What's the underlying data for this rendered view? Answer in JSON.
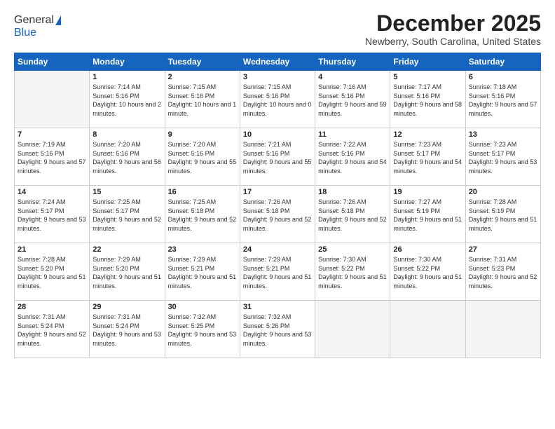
{
  "logo": {
    "general": "General",
    "blue": "Blue"
  },
  "header": {
    "month": "December 2025",
    "location": "Newberry, South Carolina, United States"
  },
  "days_of_week": [
    "Sunday",
    "Monday",
    "Tuesday",
    "Wednesday",
    "Thursday",
    "Friday",
    "Saturday"
  ],
  "weeks": [
    [
      {
        "day": "",
        "empty": true
      },
      {
        "day": "1",
        "sunrise": "7:14 AM",
        "sunset": "5:16 PM",
        "daylight": "10 hours and 2 minutes."
      },
      {
        "day": "2",
        "sunrise": "7:15 AM",
        "sunset": "5:16 PM",
        "daylight": "10 hours and 1 minute."
      },
      {
        "day": "3",
        "sunrise": "7:15 AM",
        "sunset": "5:16 PM",
        "daylight": "10 hours and 0 minutes."
      },
      {
        "day": "4",
        "sunrise": "7:16 AM",
        "sunset": "5:16 PM",
        "daylight": "9 hours and 59 minutes."
      },
      {
        "day": "5",
        "sunrise": "7:17 AM",
        "sunset": "5:16 PM",
        "daylight": "9 hours and 58 minutes."
      },
      {
        "day": "6",
        "sunrise": "7:18 AM",
        "sunset": "5:16 PM",
        "daylight": "9 hours and 57 minutes."
      }
    ],
    [
      {
        "day": "7",
        "sunrise": "7:19 AM",
        "sunset": "5:16 PM",
        "daylight": "9 hours and 57 minutes."
      },
      {
        "day": "8",
        "sunrise": "7:20 AM",
        "sunset": "5:16 PM",
        "daylight": "9 hours and 56 minutes."
      },
      {
        "day": "9",
        "sunrise": "7:20 AM",
        "sunset": "5:16 PM",
        "daylight": "9 hours and 55 minutes."
      },
      {
        "day": "10",
        "sunrise": "7:21 AM",
        "sunset": "5:16 PM",
        "daylight": "9 hours and 55 minutes."
      },
      {
        "day": "11",
        "sunrise": "7:22 AM",
        "sunset": "5:16 PM",
        "daylight": "9 hours and 54 minutes."
      },
      {
        "day": "12",
        "sunrise": "7:23 AM",
        "sunset": "5:17 PM",
        "daylight": "9 hours and 54 minutes."
      },
      {
        "day": "13",
        "sunrise": "7:23 AM",
        "sunset": "5:17 PM",
        "daylight": "9 hours and 53 minutes."
      }
    ],
    [
      {
        "day": "14",
        "sunrise": "7:24 AM",
        "sunset": "5:17 PM",
        "daylight": "9 hours and 53 minutes."
      },
      {
        "day": "15",
        "sunrise": "7:25 AM",
        "sunset": "5:17 PM",
        "daylight": "9 hours and 52 minutes."
      },
      {
        "day": "16",
        "sunrise": "7:25 AM",
        "sunset": "5:18 PM",
        "daylight": "9 hours and 52 minutes."
      },
      {
        "day": "17",
        "sunrise": "7:26 AM",
        "sunset": "5:18 PM",
        "daylight": "9 hours and 52 minutes."
      },
      {
        "day": "18",
        "sunrise": "7:26 AM",
        "sunset": "5:18 PM",
        "daylight": "9 hours and 52 minutes."
      },
      {
        "day": "19",
        "sunrise": "7:27 AM",
        "sunset": "5:19 PM",
        "daylight": "9 hours and 51 minutes."
      },
      {
        "day": "20",
        "sunrise": "7:28 AM",
        "sunset": "5:19 PM",
        "daylight": "9 hours and 51 minutes."
      }
    ],
    [
      {
        "day": "21",
        "sunrise": "7:28 AM",
        "sunset": "5:20 PM",
        "daylight": "9 hours and 51 minutes."
      },
      {
        "day": "22",
        "sunrise": "7:29 AM",
        "sunset": "5:20 PM",
        "daylight": "9 hours and 51 minutes."
      },
      {
        "day": "23",
        "sunrise": "7:29 AM",
        "sunset": "5:21 PM",
        "daylight": "9 hours and 51 minutes."
      },
      {
        "day": "24",
        "sunrise": "7:29 AM",
        "sunset": "5:21 PM",
        "daylight": "9 hours and 51 minutes."
      },
      {
        "day": "25",
        "sunrise": "7:30 AM",
        "sunset": "5:22 PM",
        "daylight": "9 hours and 51 minutes."
      },
      {
        "day": "26",
        "sunrise": "7:30 AM",
        "sunset": "5:22 PM",
        "daylight": "9 hours and 51 minutes."
      },
      {
        "day": "27",
        "sunrise": "7:31 AM",
        "sunset": "5:23 PM",
        "daylight": "9 hours and 52 minutes."
      }
    ],
    [
      {
        "day": "28",
        "sunrise": "7:31 AM",
        "sunset": "5:24 PM",
        "daylight": "9 hours and 52 minutes."
      },
      {
        "day": "29",
        "sunrise": "7:31 AM",
        "sunset": "5:24 PM",
        "daylight": "9 hours and 53 minutes."
      },
      {
        "day": "30",
        "sunrise": "7:32 AM",
        "sunset": "5:25 PM",
        "daylight": "9 hours and 53 minutes."
      },
      {
        "day": "31",
        "sunrise": "7:32 AM",
        "sunset": "5:26 PM",
        "daylight": "9 hours and 53 minutes."
      },
      {
        "day": "",
        "empty": true
      },
      {
        "day": "",
        "empty": true
      },
      {
        "day": "",
        "empty": true
      }
    ]
  ]
}
